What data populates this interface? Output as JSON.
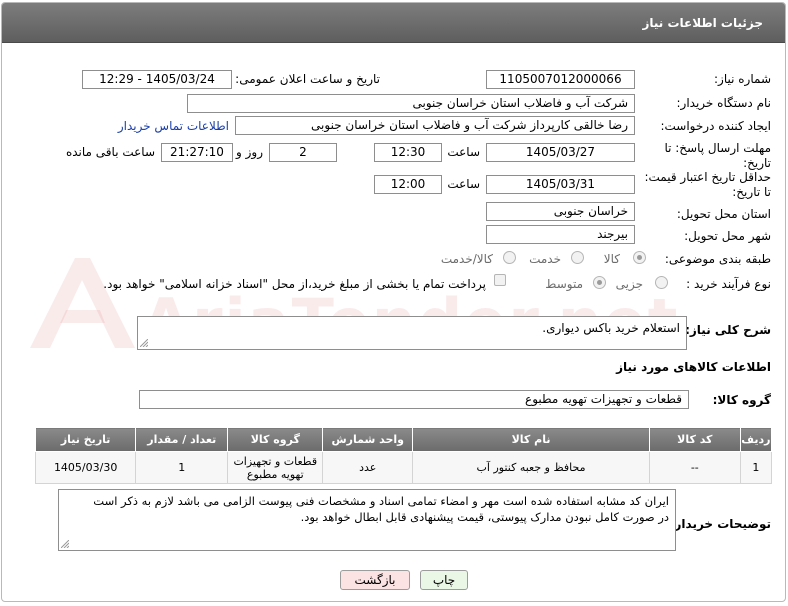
{
  "header": {
    "title": "جزئیات اطلاعات نیاز"
  },
  "watermark": {
    "text": "AriaTender.net"
  },
  "fields": {
    "need_number_label": "شماره نیاز:",
    "need_number": "1105007012000066",
    "announce_label": "تاریخ و ساعت اعلان عمومی:",
    "announce_value": "1405/03/24 - 12:29",
    "buyer_org_label": "نام دستگاه خریدار:",
    "buyer_org": "شرکت آب و فاضلاب استان خراسان جنوبی",
    "creator_label": "ایجاد کننده درخواست:",
    "creator": "رضا خالقی کارپرداز شرکت آب و فاضلاب استان خراسان جنوبی",
    "contact_link": "اطلاعات تماس خریدار",
    "reply_deadline_label_1": "مهلت ارسال پاسخ: تا",
    "reply_deadline_label_2": "تاریخ:",
    "reply_date": "1405/03/27",
    "time_label": "ساعت",
    "reply_time": "12:30",
    "days_value": "2",
    "days_label": "روز و",
    "remaining_time": "21:27:10",
    "remaining_label": "ساعت باقی مانده",
    "price_deadline_label_1": "حداقل تاریخ اعتبار قیمت:",
    "price_deadline_label_2": "تا تاریخ:",
    "price_date": "1405/03/31",
    "price_time": "12:00",
    "province_label": "استان محل تحویل:",
    "province": "خراسان جنوبی",
    "city_label": "شهر محل تحویل:",
    "city": "بیرجند",
    "category_label": "طبقه بندی موضوعی:",
    "category_options": [
      "کالا",
      "خدمت",
      "کالا/خدمت"
    ],
    "process_label": "نوع فرآیند خرید :",
    "process_options": [
      "جزیی",
      "متوسط"
    ],
    "payment_note": "پرداخت تمام یا بخشی از مبلغ خرید،از محل \"اسناد خزانه اسلامی\" خواهد بود."
  },
  "description": {
    "label": "شرح کلی نیاز:",
    "value": "استعلام خرید باکس دیواری."
  },
  "goods": {
    "section_title": "اطلاعات کالاهای مورد نیاز",
    "group_label": "گروه کالا:",
    "group_value": "قطعات و تجهیزات تهویه مطبوع",
    "columns": [
      "ردیف",
      "کد کالا",
      "نام کالا",
      "واحد شمارش",
      "گروه کالا",
      "تعداد / مقدار",
      "تاریخ نیاز"
    ],
    "rows": [
      {
        "row": "1",
        "code": "--",
        "name": "محافظ و جعبه کنتور آب",
        "unit": "عدد",
        "group_1": "قطعات و تجهیزات",
        "group_2": "تهویه مطبوع",
        "qty": "1",
        "date": "1405/03/30"
      }
    ]
  },
  "buyer_notes": {
    "label": "توضیحات خریدار:",
    "line_1": "ایران کد مشابه استفاده شده است مهر و امضاء تمامی اسناد و مشخصات فنی پیوست الزامی می باشد لازم به ذکر است",
    "line_2": "در صورت کامل نبودن  مدارک پیوستی،  قیمت پیشنهادی قابل ابطال خواهد بود."
  },
  "buttons": {
    "print": "چاپ",
    "back": "بازگشت"
  },
  "colors": {
    "titlebar": "#6b6b6b",
    "back_button": "#fbe3e3",
    "print_button": "#eaf6e6",
    "link": "#1a3ea8"
  }
}
